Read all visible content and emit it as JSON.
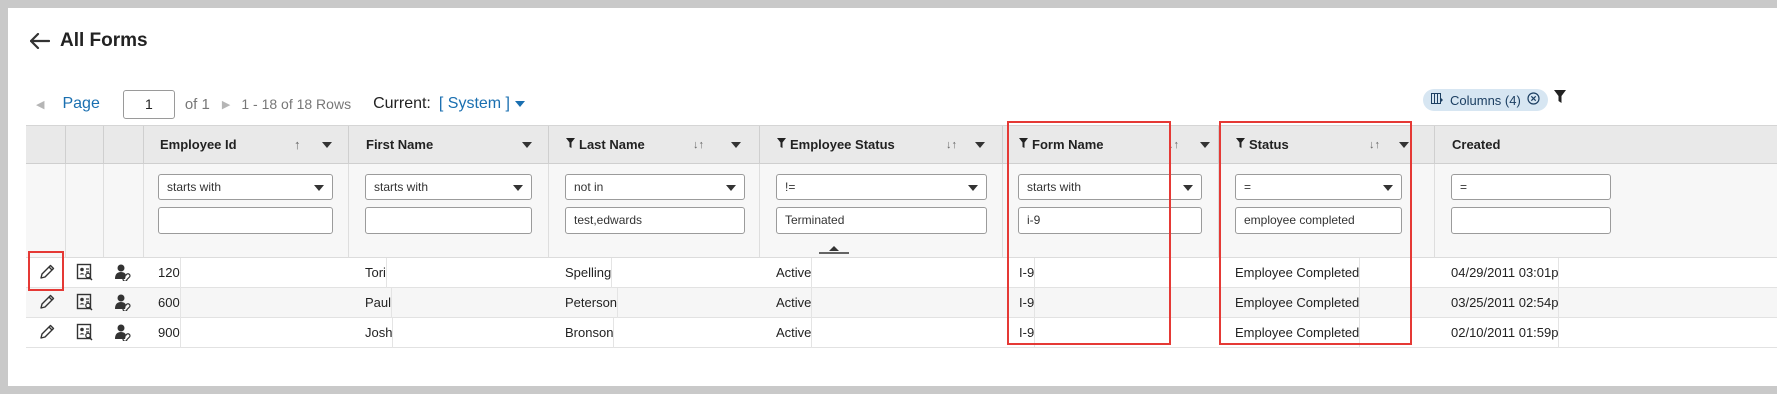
{
  "header": {
    "title": "All Forms"
  },
  "pager": {
    "page_label": "Page",
    "page_value": "1",
    "of_label": "of 1",
    "rows_label": "1 - 18 of 18 Rows",
    "current_label": "Current:",
    "current_view": "[ System ]"
  },
  "toolbar": {
    "columns_chip": "Columns (4)"
  },
  "columns": [
    {
      "label": "Employee Id",
      "filtered": false,
      "sort": "↑"
    },
    {
      "label": "First Name",
      "filtered": false,
      "sort": ""
    },
    {
      "label": "Last Name",
      "filtered": true,
      "sort": "↓↑"
    },
    {
      "label": "Employee Status",
      "filtered": true,
      "sort": "↓↑"
    },
    {
      "label": "Form Name",
      "filtered": true,
      "sort": "↓↑"
    },
    {
      "label": "Status",
      "filtered": true,
      "sort": "↓↑"
    },
    {
      "label": "Created",
      "filtered": false,
      "sort": ""
    }
  ],
  "filters": [
    {
      "operator": "starts with",
      "value": ""
    },
    {
      "operator": "starts with",
      "value": ""
    },
    {
      "operator": "not in",
      "value": "test,edwards"
    },
    {
      "operator": "!=",
      "value": "Terminated"
    },
    {
      "operator": "starts with",
      "value": "i-9"
    },
    {
      "operator": "=",
      "value": "employee completed"
    },
    {
      "operator": "=",
      "value": ""
    }
  ],
  "rows": [
    {
      "employee_id": "120",
      "first_name": "Tori",
      "last_name": "Spelling",
      "employee_status": "Active",
      "form_name": "I-9",
      "status": "Employee Completed",
      "created": "04/29/2011 03:01p"
    },
    {
      "employee_id": "600",
      "first_name": "Paul",
      "last_name": "Peterson",
      "employee_status": "Active",
      "form_name": "I-9",
      "status": "Employee Completed",
      "created": "03/25/2011 02:54p"
    },
    {
      "employee_id": "900",
      "first_name": "Josh",
      "last_name": "Bronson",
      "employee_status": "Active",
      "form_name": "I-9",
      "status": "Employee Completed",
      "created": "02/10/2011 01:59p"
    }
  ],
  "icons": [
    "back-arrow-icon",
    "prev-page-icon",
    "next-page-icon",
    "dropdown-caret-icon",
    "columns-icon",
    "clear-icon",
    "filter-icon",
    "edit-pencil-icon",
    "form-view-icon",
    "user-link-icon"
  ],
  "colors": {
    "link": "#1a6fb0",
    "highlight": "#e53935",
    "chip": "#d7e6f2"
  }
}
